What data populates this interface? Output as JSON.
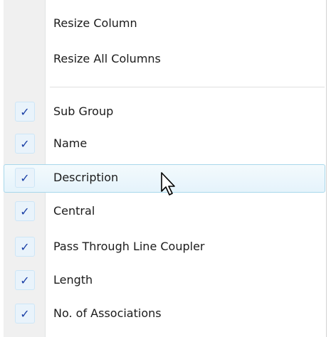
{
  "menu": {
    "actions": [
      {
        "label": "Resize Column"
      },
      {
        "label": "Resize All Columns"
      }
    ],
    "columns": [
      {
        "label": "Sub Group",
        "checked": true,
        "check_glyph": "✓"
      },
      {
        "label": "Name",
        "checked": true,
        "check_glyph": "✓"
      },
      {
        "label": "Description",
        "checked": true,
        "check_glyph": "✓",
        "hovered": true
      },
      {
        "label": "Central",
        "checked": true,
        "check_glyph": "✓"
      },
      {
        "label": "Pass Through Line Coupler",
        "checked": true,
        "check_glyph": "✓"
      },
      {
        "label": "Length",
        "checked": true,
        "check_glyph": "✓"
      },
      {
        "label": "No. of Associations",
        "checked": true,
        "check_glyph": "✓"
      }
    ]
  },
  "colors": {
    "check": "#1a3fa6",
    "hover_border": "#a8d8eb",
    "gutter": "#f0f0f0"
  },
  "icons": {
    "check": "checkmark-icon",
    "cursor": "mouse-pointer-icon"
  }
}
